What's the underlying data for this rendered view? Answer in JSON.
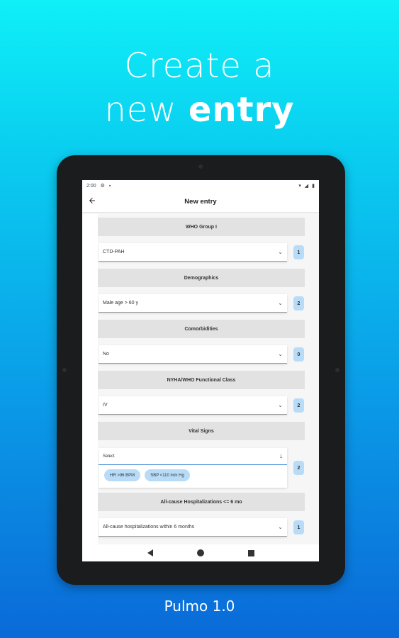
{
  "promo": {
    "line1": "Create a",
    "line2_regular": "new",
    "line2_bold": "entry",
    "footer": "Pulmo 1.0"
  },
  "statusbar": {
    "time": "2:00",
    "icons_left": [
      "settings-icon",
      "notification-icon"
    ],
    "icons_right": [
      "wifi-icon",
      "signal-icon",
      "battery-icon"
    ]
  },
  "appbar": {
    "title": "New entry",
    "back_icon": "arrow-back-icon"
  },
  "sections": [
    {
      "header": "WHO Group I",
      "value": "CTD-PAH",
      "score": "1"
    },
    {
      "header": "Demographics",
      "value": "Male age > 60 y",
      "score": "2"
    },
    {
      "header": "Comorbidities",
      "value": "No",
      "score": "0"
    },
    {
      "header": "NYHA/WHO Functional Class",
      "value": "IV",
      "score": "2"
    },
    {
      "header": "Vital Signs",
      "placeholder": "Select",
      "chips": [
        "HR >96 BPM",
        "SBP <110 mm Hg"
      ],
      "score": "2"
    },
    {
      "header": "All-cause Hospitalizations <= 6 mo",
      "value": "All-cause hospitalizations within 6 months",
      "score": "1"
    }
  ],
  "navbar": {
    "icons": [
      "nav-back-icon",
      "nav-home-icon",
      "nav-recents-icon"
    ]
  }
}
